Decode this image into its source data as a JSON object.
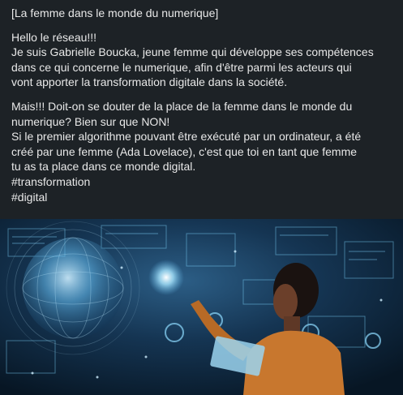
{
  "post": {
    "headline": "[La femme dans le monde du numerique]",
    "paragraph1": [
      "Hello le réseau!!!",
      "Je suis Gabrielle Boucka, jeune femme qui développe ses compétences",
      "dans ce qui concerne le numerique, afin d'être parmi les acteurs qui",
      "vont apporter la transformation digitale dans la société."
    ],
    "paragraph2": [
      "Mais!!! Doit-on se douter de la place de la femme dans le monde du",
      "numerique? Bien sur que NON!",
      "Si le premier algorithme pouvant être exécuté par un ordinateur, a été",
      "créé par une femme (Ada Lovelace), c'est que toi en tant que femme",
      "tu as ta place dans ce monde digital."
    ],
    "hashtags": [
      "#transformation",
      "#digital"
    ]
  },
  "colors": {
    "background": "#1d2226",
    "text": "#e8e8e8",
    "image_glow": "#7fd6ff"
  },
  "image": {
    "subject": "woman-touching-holographic-globe-interface"
  }
}
